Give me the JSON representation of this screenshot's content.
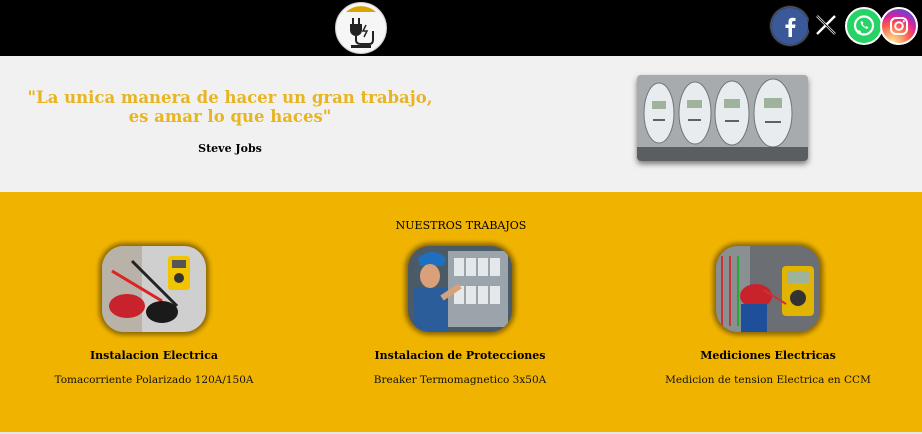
{
  "header": {
    "logo_icon": "plug-logo-icon",
    "social": [
      {
        "name": "facebook",
        "icon": "facebook-icon",
        "glyph": "f",
        "color": "#3b5998"
      },
      {
        "name": "x",
        "icon": "x-icon",
        "glyph": "X",
        "color": "#000000"
      },
      {
        "name": "whatsapp",
        "icon": "whatsapp-icon",
        "color": "#25d366"
      },
      {
        "name": "instagram",
        "icon": "instagram-icon",
        "color": "#d6249f"
      }
    ]
  },
  "hero": {
    "quote": "\"La unica manera de hacer un gran trabajo, es amar lo que haces\"",
    "author": "Steve Jobs",
    "image_icon": "electric-meters-image"
  },
  "works": {
    "title": "NUESTROS TRABAJOS",
    "items": [
      {
        "title": "Instalacion Electrica",
        "description": "Tomacorriente Polarizado 120A/150A",
        "image": "multimeter-photo"
      },
      {
        "title": "Instalacion de Protecciones",
        "description": "Breaker Termomagnetico 3x50A",
        "image": "electrician-panel-photo"
      },
      {
        "title": "Mediciones Electricas",
        "description": "Medicion de tension Electrica en CCM",
        "image": "voltage-measurement-photo"
      }
    ]
  },
  "colors": {
    "header_bg": "#000000",
    "hero_bg": "#f1f1f1",
    "accent_yellow": "#f0b400",
    "quote_color": "#e8b420"
  }
}
